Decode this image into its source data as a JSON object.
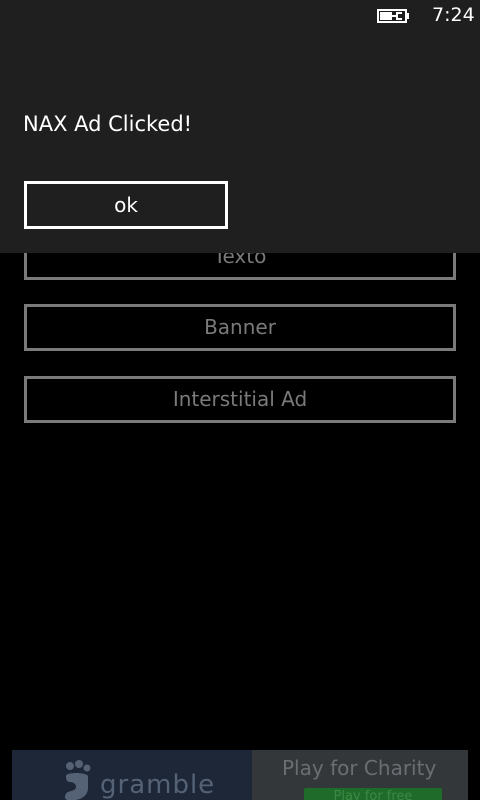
{
  "status_bar": {
    "time": "7:24",
    "battery_icon": "battery-charging-icon"
  },
  "dialog": {
    "message": "NAX Ad Clicked!",
    "ok_label": "ok"
  },
  "app": {
    "buttons": [
      {
        "label": "Texto"
      },
      {
        "label": "Banner"
      },
      {
        "label": "Interstitial Ad"
      }
    ]
  },
  "ad_banner": {
    "brand": "gramble",
    "tagline": "Play for Charity",
    "cta": "Play for free",
    "colors": {
      "left_bg": "#1d2738",
      "right_bg": "#34373a",
      "cta_bg": "#1f6b2a"
    }
  },
  "colors": {
    "background": "#000000",
    "dialog_bg": "#1f1f1f",
    "button_border_dim": "#7a7a7a",
    "foreground": "#ffffff"
  }
}
